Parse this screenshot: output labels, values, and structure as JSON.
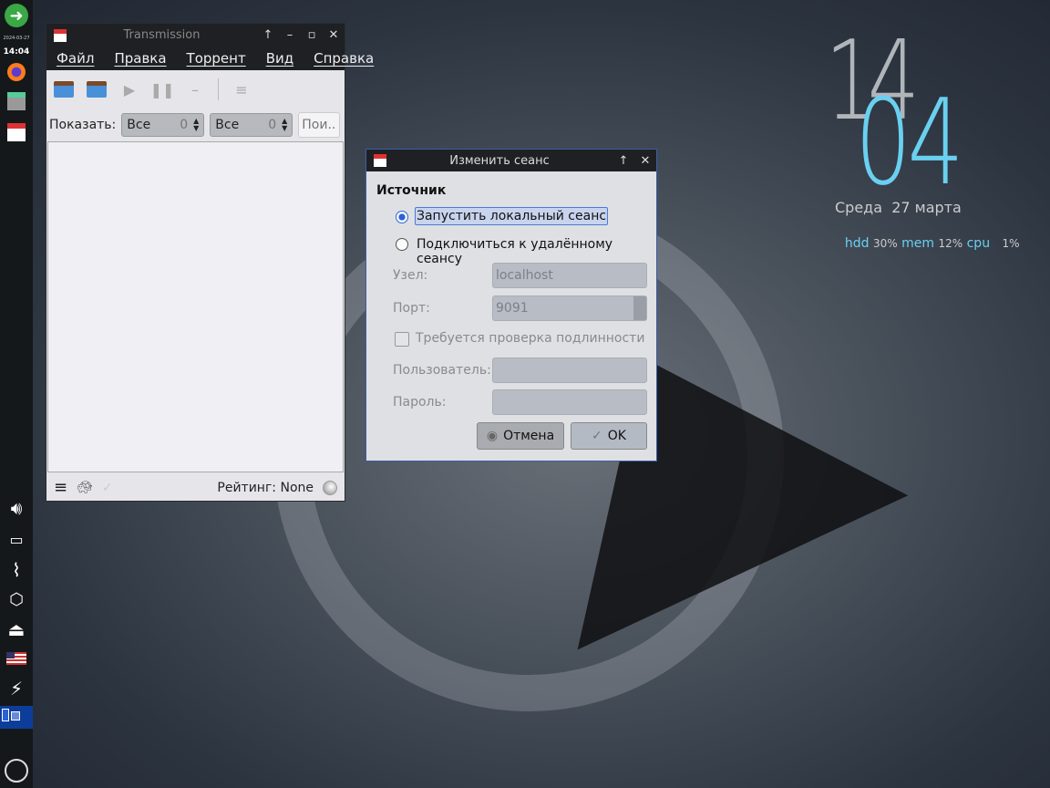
{
  "panel": {
    "date": "2024-03-27",
    "time": "14:04"
  },
  "clock": {
    "hours": "14",
    "minutes": "04",
    "date": "Среда  27 марта",
    "hdd_label": "hdd",
    "hdd": "30%",
    "mem_label": "mem",
    "mem": "12%",
    "cpu_label": "cpu",
    "cpu": "1%"
  },
  "main": {
    "title": "Transmission",
    "menu": [
      "Файл",
      "Правка",
      "Торрент",
      "Вид",
      "Справка"
    ],
    "filter": {
      "label": "Показать:",
      "f1": "Все",
      "f1n": "0",
      "f2": "Все",
      "f2n": "0",
      "search_placeholder": "Пои..."
    },
    "status": {
      "rating": "Рейтинг: None"
    }
  },
  "dialog": {
    "title": "Изменить сеанс",
    "section": "Источник",
    "local": "Запустить локальный сеанс",
    "remote": "Подключиться к удалённому сеансу",
    "host_label": "Узел:",
    "host": "localhost",
    "port_label": "Порт:",
    "port": "9091",
    "auth": "Требуется проверка подлинности",
    "user_label": "Пользователь:",
    "pass_label": "Пароль:",
    "cancel": "Отмена",
    "ok": "OK"
  },
  "colors": {
    "accent": "#2a62d6",
    "clock_minutes": "#6ad0f0"
  }
}
